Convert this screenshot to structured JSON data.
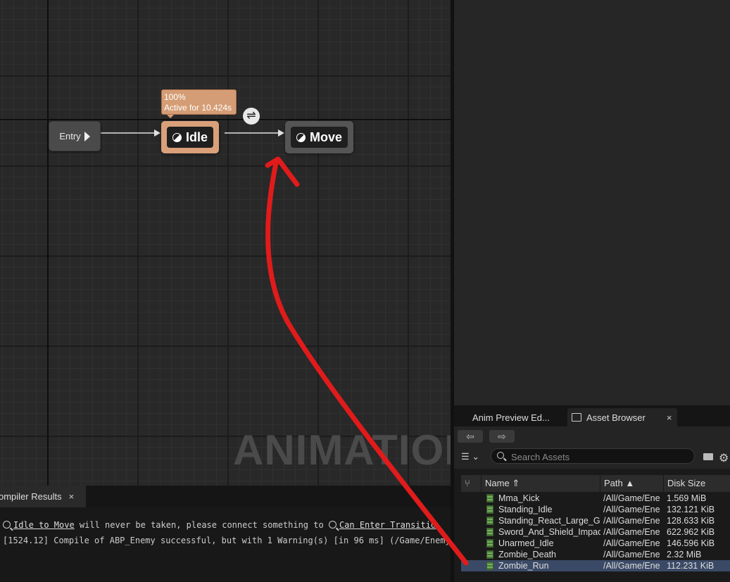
{
  "graph": {
    "entry_label": "Entry",
    "tooltip_line1": "100%",
    "tooltip_line2": "Active for 10.424s",
    "idle_label": "Idle",
    "move_label": "Move",
    "watermark": "ANIMATION"
  },
  "compiler": {
    "tab_label": "ompiler Results",
    "tab_close": "×",
    "line1_link1": "Idle to Move",
    "line1_mid": " will never be taken, please connect something to ",
    "line1_link2": "Can Enter Transitio",
    "line2": "[1524.12] Compile of ABP_Enemy successful, but with 1 Warning(s) [in 96 ms] (/Game/Enemy/"
  },
  "asset_panel": {
    "tab_anim_preview": "Anim Preview Ed...",
    "tab_asset_browser": "Asset Browser",
    "tab_close": "×",
    "back_icon": "arrow-left-icon",
    "forward_icon": "arrow-right-icon",
    "search_placeholder": "Search Assets",
    "columns": {
      "name": "Name",
      "path": "Path",
      "size": "Disk Size"
    },
    "rows": [
      {
        "name": "Mma_Kick",
        "path": "/All/Game/Ene",
        "size": "1.569 MiB"
      },
      {
        "name": "Standing_Idle",
        "path": "/All/Game/Ene",
        "size": "132.121 KiB"
      },
      {
        "name": "Standing_React_Large_G",
        "path": "/All/Game/Ene",
        "size": "128.633 KiB"
      },
      {
        "name": "Sword_And_Shield_Impac",
        "path": "/All/Game/Ene",
        "size": "622.962 KiB"
      },
      {
        "name": "Unarmed_Idle",
        "path": "/All/Game/Ene",
        "size": "146.596 KiB"
      },
      {
        "name": "Zombie_Death",
        "path": "/All/Game/Ene",
        "size": "2.32 MiB"
      },
      {
        "name": "Zombie_Run",
        "path": "/All/Game/Ene",
        "size": "112.231 KiB"
      }
    ],
    "selected_row": "Zombie_Run"
  },
  "colors": {
    "active_state": "#d9a07a",
    "annotation": "#e01b1b",
    "selection": "#3a4a66"
  }
}
